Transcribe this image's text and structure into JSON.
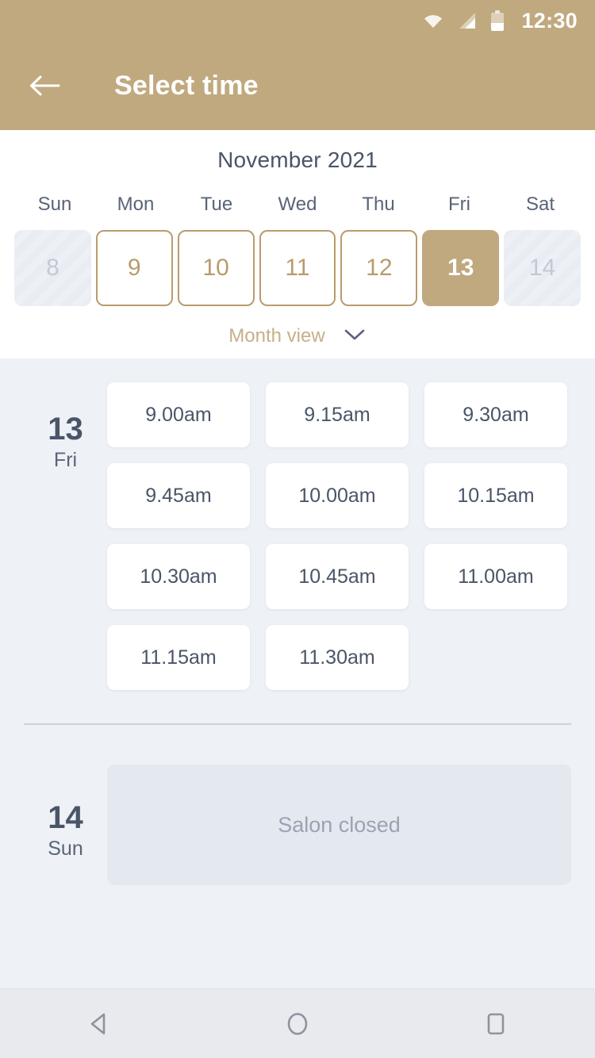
{
  "statusbar": {
    "time": "12:30",
    "icons": [
      "wifi-icon",
      "cellular-signal-icon",
      "battery-icon"
    ]
  },
  "appbar": {
    "back_icon": "arrow-left-icon",
    "title": "Select time"
  },
  "calendar": {
    "month_title": "November 2021",
    "weekdays": [
      "Sun",
      "Mon",
      "Tue",
      "Wed",
      "Thu",
      "Fri",
      "Sat"
    ],
    "days": [
      {
        "num": "8",
        "state": "disabled"
      },
      {
        "num": "9",
        "state": "available"
      },
      {
        "num": "10",
        "state": "available"
      },
      {
        "num": "11",
        "state": "available"
      },
      {
        "num": "12",
        "state": "available"
      },
      {
        "num": "13",
        "state": "selected"
      },
      {
        "num": "14",
        "state": "disabled"
      }
    ],
    "toggle_label": "Month view",
    "toggle_icon": "chevron-down-icon"
  },
  "schedule": [
    {
      "day_number": "13",
      "day_of_week": "Fri",
      "slots": [
        "9.00am",
        "9.15am",
        "9.30am",
        "9.45am",
        "10.00am",
        "10.15am",
        "10.30am",
        "10.45am",
        "11.00am",
        "11.15am",
        "11.30am"
      ],
      "closed_message": null
    },
    {
      "day_number": "14",
      "day_of_week": "Sun",
      "slots": [],
      "closed_message": "Salon closed"
    }
  ],
  "navbar": {
    "items": [
      {
        "name": "back-nav-icon",
        "glyph": "triangle-left"
      },
      {
        "name": "home-nav-icon",
        "glyph": "circle"
      },
      {
        "name": "recents-nav-icon",
        "glyph": "square"
      }
    ]
  },
  "colors": {
    "brand": "#c0a97f",
    "brand_border": "#b89c6d",
    "text_dark": "#4a5568",
    "page_bg": "#eef1f6",
    "closed_bg": "#e4e8ef"
  }
}
